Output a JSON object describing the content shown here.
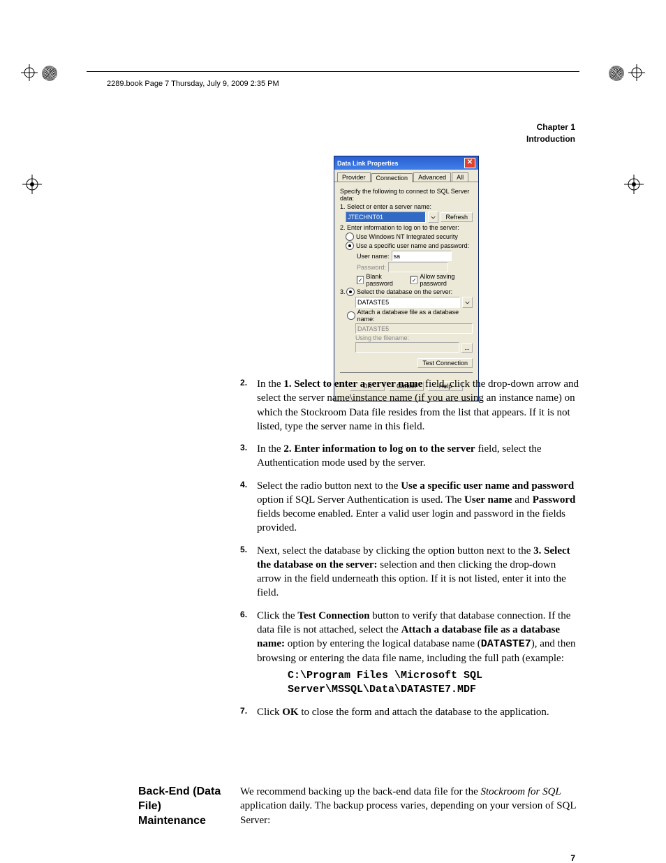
{
  "header_meta": "2289.book  Page 7  Thursday, July 9, 2009  2:35 PM",
  "chapter_line1": "Chapter 1",
  "chapter_line2": "Introduction",
  "page_number": "7",
  "dialog": {
    "title": "Data Link Properties",
    "tabs": {
      "provider": "Provider",
      "connection": "Connection",
      "advanced": "Advanced",
      "all": "All"
    },
    "intro": "Specify the following to connect to SQL Server data:",
    "step1_label": "1. Select or enter a server name:",
    "server_value": "JTECHNT01",
    "refresh": "Refresh",
    "step2_label": "2. Enter information to log on to the server:",
    "radio_nt": "Use Windows NT Integrated security",
    "radio_specific": "Use a specific user name and password:",
    "username_label": "User name:",
    "username_value": "sa",
    "password_label": "Password:",
    "blank_pw": "Blank password",
    "allow_save": "Allow saving password",
    "step3_label": "Select the database on the server:",
    "db_value": "DATASTE5",
    "attach_label": "Attach a database file as a database name:",
    "attach_value": "DATASTE5",
    "filename_label": "Using the filename:",
    "test": "Test Connection",
    "ok": "OK",
    "cancel": "Cancel",
    "help": "Help"
  },
  "steps": {
    "s2a": "In the ",
    "s2b": "1. Select to enter a server name",
    "s2c": " field, click the drop-down arrow and select the server name\\instance name (if you are using an instance name) on which the Stockroom Data file resides from the list that appears. If it is not listed, type the server name in this field.",
    "s3a": "In the ",
    "s3b": "2. Enter information to log on to the server",
    "s3c": " field, select the Authentication mode used by the server.",
    "s4a": "Select the radio button next to the ",
    "s4b": "Use a specific user name and password",
    "s4c": " option if SQL Server Authentication is used. The ",
    "s4d": "User name",
    "s4e": " and ",
    "s4f": "Password",
    "s4g": " fields become enabled. Enter a valid user login and password in the fields provided.",
    "s5a": "Next, select the database by clicking the option button next to the ",
    "s5b": "3. Select the database on the server:",
    "s5c": " selection and then clicking the drop-down arrow in the field underneath this option. If it is not listed, enter it into the field.",
    "s6a": "Click the ",
    "s6b": "Test Connection",
    "s6c": " button to verify that database connection. If the data file is not attached, select the ",
    "s6d": "Attach a database file as a database name:",
    "s6e": " option by entering the logical database name (",
    "s6f": "DATASTE7",
    "s6g": "), and then browsing or entering the data file name, including the full path (example:",
    "code1": "C:\\Program Files \\Microsoft SQL",
    "code2": "Server\\MSSQL\\Data\\DATASTE7.MDF",
    "s7a": "Click ",
    "s7b": "OK",
    "s7c": " to close the form and attach the database to the application."
  },
  "sidehead": "Back-End (Data File) Maintenance",
  "maint_a": "We recommend backing up the back-end data file for the ",
  "maint_b": "Stockroom for SQL",
  "maint_c": " application daily. The backup process varies, depending on your version of SQL Server:"
}
